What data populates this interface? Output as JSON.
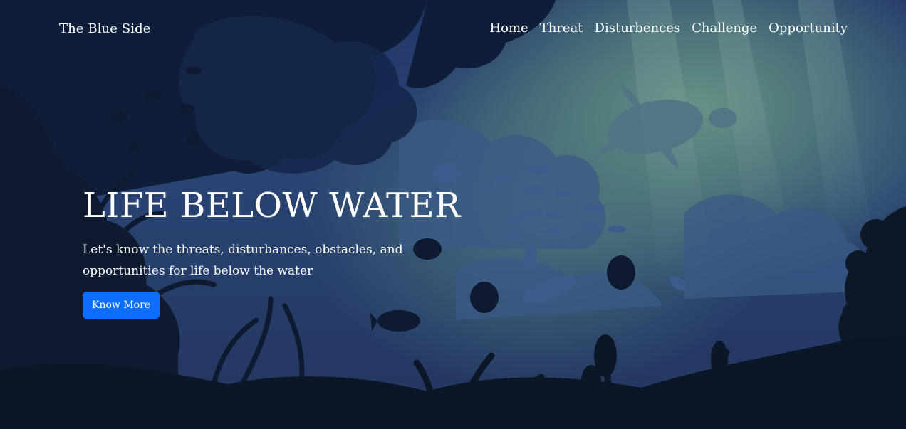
{
  "navbar": {
    "brand": "The Blue Side",
    "links": [
      {
        "label": "Home"
      },
      {
        "label": "Threat"
      },
      {
        "label": "Disturbences"
      },
      {
        "label": "Challenge"
      },
      {
        "label": "Opportunity"
      }
    ]
  },
  "hero": {
    "title": "LIFE BELOW WATER",
    "subtitle": "Let's know the threats, disturbances, obstacles, and opportunities for life below the water",
    "button_label": "Know More"
  },
  "colors": {
    "button_bg": "#0d6efd",
    "text": "#ffffff",
    "deep_water": "#0b1626",
    "mid_water": "#2a4474",
    "light_water": "#69968a"
  }
}
